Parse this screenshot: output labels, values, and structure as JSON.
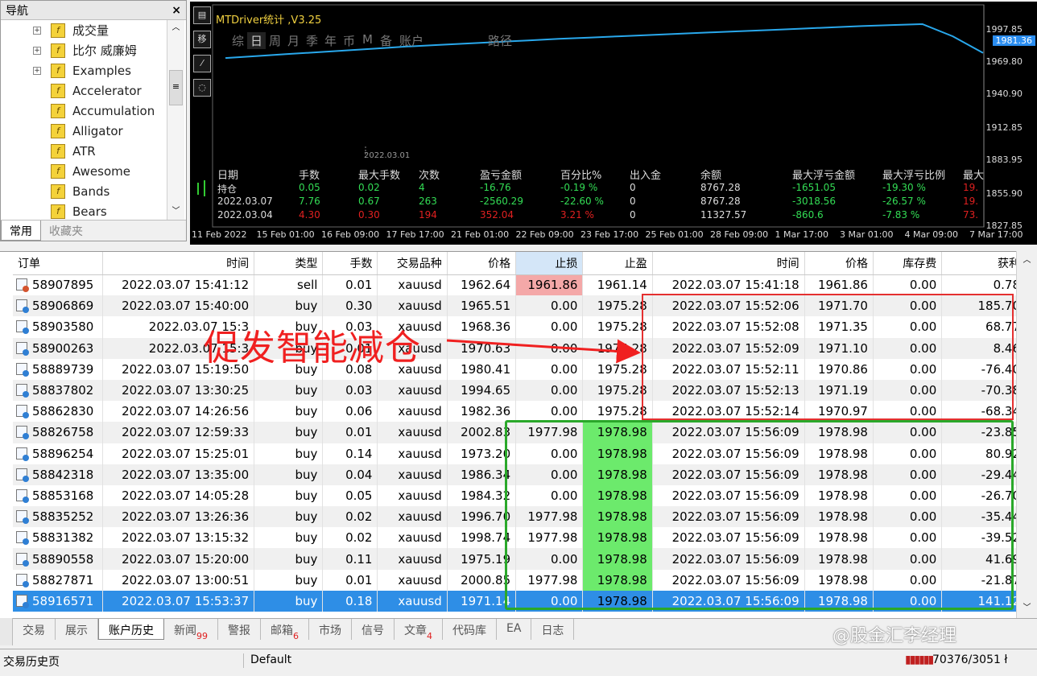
{
  "navigator": {
    "title": "导航",
    "close": "×",
    "items": [
      {
        "label": "成交量",
        "expand": true
      },
      {
        "label": "比尔 威廉姆",
        "expand": true
      },
      {
        "label": "Examples",
        "expand": true
      },
      {
        "label": "Accelerator",
        "expand": false
      },
      {
        "label": "Accumulation",
        "expand": false
      },
      {
        "label": "Alligator",
        "expand": false
      },
      {
        "label": "ATR",
        "expand": false
      },
      {
        "label": "Awesome",
        "expand": false
      },
      {
        "label": "Bands",
        "expand": false
      },
      {
        "label": "Bears",
        "expand": false
      }
    ],
    "tabs": [
      "常用",
      "收藏夹"
    ]
  },
  "chart": {
    "title": "MTDriver统计 ,V3.25",
    "periods": [
      "综",
      "日",
      "周",
      "月",
      "季",
      "年",
      "币",
      "M",
      "备",
      "账户",
      "路径"
    ],
    "date_marker": "2022.03.01",
    "price_tag": "1981.36",
    "yticks": [
      "1997.85",
      "1969.80",
      "1940.90",
      "1912.85",
      "1883.95",
      "1855.90",
      "1827.85"
    ],
    "xticks": [
      "11 Feb 2022",
      "15 Feb 01:00",
      "16 Feb 09:00",
      "17 Feb 17:00",
      "21 Feb 01:00",
      "22 Feb 09:00",
      "23 Feb 17:00",
      "25 Feb 01:00",
      "28 Feb 09:00",
      "1 Mar 17:00",
      "3 Mar 01:00",
      "4 Mar 09:00",
      "7 Mar 17:00"
    ],
    "stats_header": [
      "日期",
      "手数",
      "最大手数",
      "次数",
      "盈亏金额",
      "百分比%",
      "出入金",
      "余额",
      "最大浮亏金额",
      "最大浮亏比例",
      "最大"
    ],
    "stats_rows": [
      [
        "持仓",
        "0.05",
        "0.02",
        "4",
        "-16.76",
        "-0.19 %",
        "0",
        "8767.28",
        "-1651.05",
        "-19.30 %",
        "19."
      ],
      [
        "2022.03.07",
        "7.76",
        "0.67",
        "263",
        "-2560.29",
        "-22.60 %",
        "0",
        "8767.28",
        "-3018.56",
        "-26.57 %",
        "19."
      ],
      [
        "2022.03.04",
        "4.30",
        "0.30",
        "194",
        "352.04",
        "3.21 %",
        "0",
        "11327.57",
        "-860.6",
        "-7.83 %",
        "73."
      ]
    ],
    "series": [
      1960,
      1961.5,
      1963,
      1964.5,
      1966,
      1967.5,
      1969,
      1970.2,
      1971.4,
      1972.6,
      1973.8,
      1975,
      1976,
      1977,
      1978,
      1979,
      1980,
      1981,
      1982,
      1983,
      1984,
      1985,
      1985.8,
      1986.5,
      1977,
      1964
    ]
  },
  "table": {
    "headers": [
      "订单",
      "时间",
      "类型",
      "手数",
      "交易品种",
      "价格",
      "止损",
      "止盈",
      "时间",
      "价格",
      "库存费",
      "获利"
    ],
    "rows": [
      [
        "58907895",
        "2022.03.07 15:41:12",
        "sell",
        "0.01",
        "xauusd",
        "1962.64",
        "1961.86",
        "1961.14",
        "2022.03.07 15:41:18",
        "1961.86",
        "0.00",
        "0.78"
      ],
      [
        "58906869",
        "2022.03.07 15:40:00",
        "buy",
        "0.30",
        "xauusd",
        "1965.51",
        "0.00",
        "1975.28",
        "2022.03.07 15:52:06",
        "1971.70",
        "0.00",
        "185.70"
      ],
      [
        "58903580",
        "2022.03.07 15:3",
        "buy",
        "0.03",
        "xauusd",
        "1968.36",
        "0.00",
        "1975.28",
        "2022.03.07 15:52:08",
        "1971.35",
        "0.00",
        "68.77"
      ],
      [
        "58900263",
        "2022.03.07 15:3",
        "buy",
        "0.01",
        "xauusd",
        "1970.63",
        "0.00",
        "1975.28",
        "2022.03.07 15:52:09",
        "1971.10",
        "0.00",
        "8.46"
      ],
      [
        "58889739",
        "2022.03.07 15:19:50",
        "buy",
        "0.08",
        "xauusd",
        "1980.41",
        "0.00",
        "1975.28",
        "2022.03.07 15:52:11",
        "1970.86",
        "0.00",
        "-76.40"
      ],
      [
        "58837802",
        "2022.03.07 13:30:25",
        "buy",
        "0.03",
        "xauusd",
        "1994.65",
        "0.00",
        "1975.28",
        "2022.03.07 15:52:13",
        "1971.19",
        "0.00",
        "-70.38"
      ],
      [
        "58862830",
        "2022.03.07 14:26:56",
        "buy",
        "0.06",
        "xauusd",
        "1982.36",
        "0.00",
        "1975.28",
        "2022.03.07 15:52:14",
        "1970.97",
        "0.00",
        "-68.34"
      ],
      [
        "58826758",
        "2022.03.07 12:59:33",
        "buy",
        "0.01",
        "xauusd",
        "2002.83",
        "1977.98",
        "1978.98",
        "2022.03.07 15:56:09",
        "1978.98",
        "0.00",
        "-23.85"
      ],
      [
        "58896254",
        "2022.03.07 15:25:01",
        "buy",
        "0.14",
        "xauusd",
        "1973.20",
        "0.00",
        "1978.98",
        "2022.03.07 15:56:09",
        "1978.98",
        "0.00",
        "80.92"
      ],
      [
        "58842318",
        "2022.03.07 13:35:00",
        "buy",
        "0.04",
        "xauusd",
        "1986.34",
        "0.00",
        "1978.98",
        "2022.03.07 15:56:09",
        "1978.98",
        "0.00",
        "-29.44"
      ],
      [
        "58853168",
        "2022.03.07 14:05:28",
        "buy",
        "0.05",
        "xauusd",
        "1984.32",
        "0.00",
        "1978.98",
        "2022.03.07 15:56:09",
        "1978.98",
        "0.00",
        "-26.70"
      ],
      [
        "58835252",
        "2022.03.07 13:26:36",
        "buy",
        "0.02",
        "xauusd",
        "1996.70",
        "1977.98",
        "1978.98",
        "2022.03.07 15:56:09",
        "1978.98",
        "0.00",
        "-35.44"
      ],
      [
        "58831382",
        "2022.03.07 13:15:32",
        "buy",
        "0.02",
        "xauusd",
        "1998.74",
        "1977.98",
        "1978.98",
        "2022.03.07 15:56:09",
        "1978.98",
        "0.00",
        "-39.52"
      ],
      [
        "58890558",
        "2022.03.07 15:20:00",
        "buy",
        "0.11",
        "xauusd",
        "1975.19",
        "0.00",
        "1978.98",
        "2022.03.07 15:56:09",
        "1978.98",
        "0.00",
        "41.69"
      ],
      [
        "58827871",
        "2022.03.07 13:00:51",
        "buy",
        "0.01",
        "xauusd",
        "2000.85",
        "1977.98",
        "1978.98",
        "2022.03.07 15:56:09",
        "1978.98",
        "0.00",
        "-21.87"
      ],
      [
        "58916571",
        "2022.03.07 15:53:37",
        "buy",
        "0.18",
        "xauusd",
        "1971.14",
        "0.00",
        "1978.98",
        "2022.03.07 15:56:09",
        "1978.98",
        "0.00",
        "141.12"
      ]
    ],
    "selected_row": 15
  },
  "annotation": "促发智能减仓",
  "bottom_tabs": [
    {
      "label": "交易",
      "badge": ""
    },
    {
      "label": "展示",
      "badge": ""
    },
    {
      "label": "账户历史",
      "badge": ""
    },
    {
      "label": "新闻",
      "badge": "99"
    },
    {
      "label": "警报",
      "badge": ""
    },
    {
      "label": "邮箱",
      "badge": "6"
    },
    {
      "label": "市场",
      "badge": ""
    },
    {
      "label": "信号",
      "badge": ""
    },
    {
      "label": "文章",
      "badge": "4"
    },
    {
      "label": "代码库",
      "badge": ""
    },
    {
      "label": "EA",
      "badge": ""
    },
    {
      "label": "日志",
      "badge": ""
    }
  ],
  "status": {
    "left": "交易历史页",
    "profile": "Default",
    "traffic": "70376/3051 ł"
  },
  "watermark": "@股金汇李经理"
}
